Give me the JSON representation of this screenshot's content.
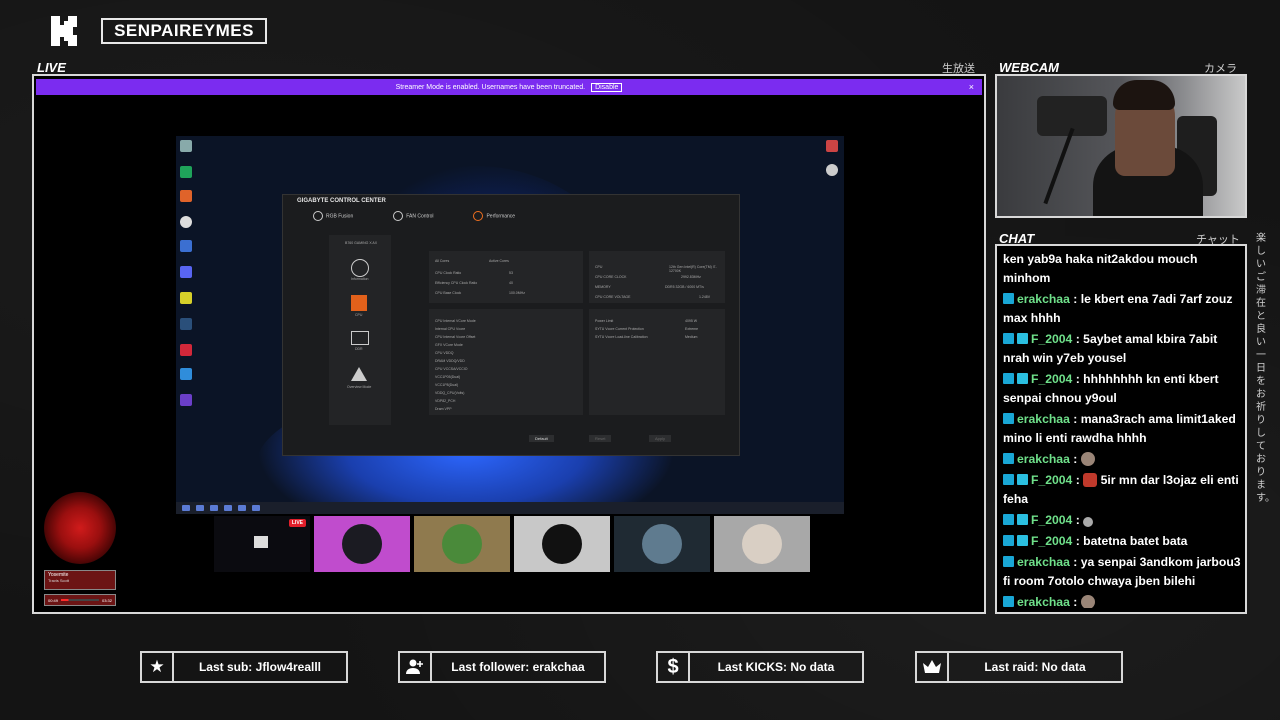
{
  "channel": {
    "name": "SENPAIREYMES"
  },
  "live_panel": {
    "label": "LIVE",
    "jp_label": "生放送"
  },
  "streamer_mode": {
    "text": "Streamer Mode is enabled. Usernames have been truncated.",
    "button": "Disable",
    "close": "×"
  },
  "gigabyte": {
    "title": "GIGABYTE CONTROL CENTER",
    "tabs": [
      "RGB Fusion",
      "FAN Control",
      "Performance"
    ],
    "board": "B760 GAMING X AX",
    "side_items": [
      "Information",
      "CPU",
      "DDR",
      "Overview Mode"
    ],
    "props": [
      "All Cores",
      "Active Cores"
    ],
    "cpu_rows": [
      "CPU Clock Ratio",
      "Efficiency CPU Clock Ratio",
      "CPU Base Clock"
    ],
    "cpu_values": [
      "53",
      "40",
      "100.0MHz"
    ],
    "status": [
      {
        "label": "CPU",
        "value": "12th Gen Intel(R) Core(TM) i7-12700K"
      },
      {
        "label": "CPU CORE CLOCK",
        "value": "2992.83MHz"
      },
      {
        "label": "MEMORY",
        "value": "DDR5 32GB / 6000 MT/s"
      },
      {
        "label": "CPU CORE VOLTAGE",
        "value": "1.248V"
      }
    ],
    "voltage_rows": [
      "CPU Internal VCore Mode",
      "Internal CPU Vcore",
      "CPU Internal Vcore Offset",
      "GFX VCore Mode",
      "CPU VDDQ",
      "DRAM VDDQ/VDD",
      "CPU VCCSA/VCCIO",
      "VCC1P05(Dual)",
      "VCC1P8(Dual)",
      "VDDQ_CPU(Volts)",
      "VDP82_PCH",
      "Dram VPP"
    ],
    "power_rows": [
      "Power Limit",
      "SYTU Vcore Current Protection",
      "SYTU Vcore Load-line Calibration"
    ],
    "power_values": [
      "4095 W",
      "Extreme",
      "Medium"
    ],
    "buttons": [
      "Default",
      "Reset",
      "Apply"
    ]
  },
  "participants": [
    {
      "name": "screen-share",
      "live": "LIVE"
    },
    {
      "name": "pink-avatar"
    },
    {
      "name": "man-avatar"
    },
    {
      "name": "wolf-avatar"
    },
    {
      "name": "character-avatar"
    },
    {
      "name": "hamster-avatar"
    }
  ],
  "music": {
    "title": "Yosemite",
    "artist": "Travis Scott",
    "elapsed": "00:49",
    "remaining": "03:32",
    "progress": 0.2
  },
  "webcam": {
    "label": "WEBCAM",
    "jp_label": "カメラ"
  },
  "chat": {
    "label": "CHAT",
    "jp_label": "チャット",
    "messages": [
      {
        "user": "",
        "text": "ken yab9a haka nit2akdou mouch minhom",
        "badges": 0
      },
      {
        "user": "erakchaa",
        "text": " : le kbert ena 7adi 7arf zouz max hhhh",
        "badges": 1
      },
      {
        "user": "F_2004",
        "text": " : 5aybet amal kbira 7abit nrah win y7eb yousel",
        "badges": 2
      },
      {
        "user": "F_2004",
        "text": " : hhhhhhhh kn enti kbert senpai chnou y9oul",
        "badges": 2
      },
      {
        "user": "erakchaa",
        "text": " : mana3rach ama limit1aked mino li enti rawdha hhhh",
        "badges": 1
      },
      {
        "user": "erakchaa",
        "text": " : ",
        "badges": 1,
        "emote": "emote"
      },
      {
        "user": "F_2004",
        "text": " : ",
        "badges": 2,
        "emote": "red",
        "after": " 5ir mn dar l3ojaz eli enti feha"
      },
      {
        "user": "F_2004",
        "text": " : ",
        "badges": 2,
        "emote": "small"
      },
      {
        "user": "F_2004",
        "text": " : batetna batet bata",
        "badges": 2
      },
      {
        "user": "erakchaa",
        "text": " : ya senpai 3andkom jarbou3 fi room 7otolo chwaya jben bilehi",
        "badges": 1
      },
      {
        "user": "erakchaa",
        "text": " : ",
        "badges": 1,
        "emote": "emote"
      }
    ]
  },
  "side_jp": "楽しいご滞在と良い一日をお祈りしております。",
  "stats": {
    "sub": "Last sub: Jflow4realll",
    "follower": "Last follower: erakchaa",
    "kicks": "Last KICKS: No data",
    "raid": "Last raid: No data"
  },
  "icons": {
    "sub": "star-icon",
    "follower": "add-user-icon",
    "kicks": "dollar-icon",
    "raid": "crown-icon"
  },
  "colors": {
    "accent": "#7b2cf0",
    "chat_user": "#6fe08a",
    "badge": "#19a7d6",
    "live": "#e21f2b"
  }
}
